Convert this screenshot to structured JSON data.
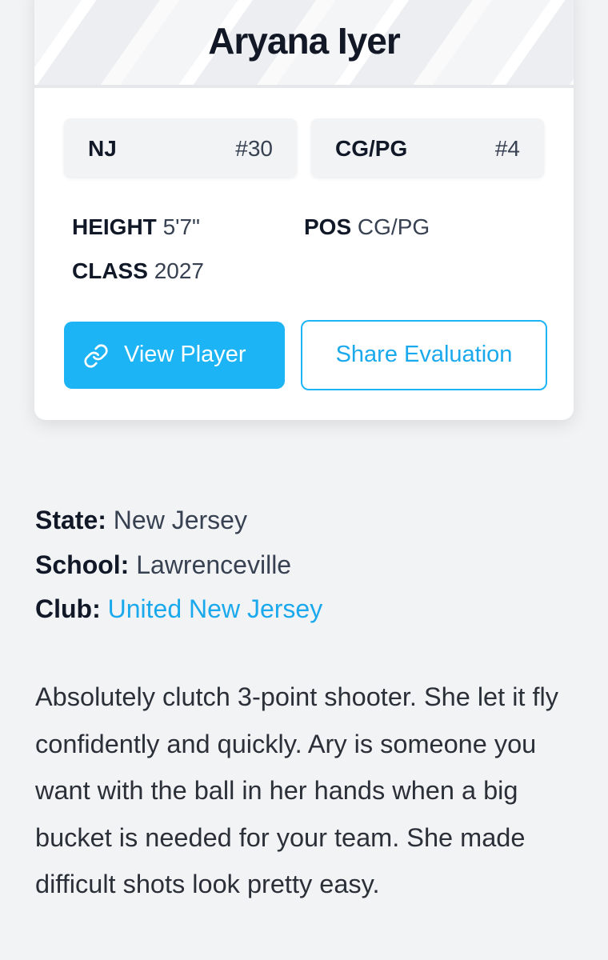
{
  "player": {
    "name": "Aryana Iyer",
    "state_abbr": "NJ",
    "jersey": "#30",
    "position_chip": "CG/PG",
    "rank": "#4"
  },
  "stats": {
    "height_label": "HEIGHT",
    "height_value": "5'7\"",
    "pos_label": "POS",
    "pos_value": "CG/PG",
    "class_label": "CLASS",
    "class_value": "2027"
  },
  "buttons": {
    "view_player": "View Player",
    "share_evaluation": "Share Evaluation",
    "view_player_icon": "link-icon"
  },
  "details": {
    "state_label": "State:",
    "state_value": "New Jersey",
    "school_label": "School:",
    "school_value": "Lawrenceville",
    "club_label": "Club:",
    "club_value": "United New Jersey"
  },
  "evaluation": "Absolutely clutch 3-point shooter. She let it fly confidently and quickly. Ary is someone you want with the ball in her hands when a big bucket is needed for your team. She made difficult shots look pretty easy.",
  "colors": {
    "accent": "#1db4f5",
    "link": "#1aa9ec",
    "background": "#f2f3f5"
  }
}
